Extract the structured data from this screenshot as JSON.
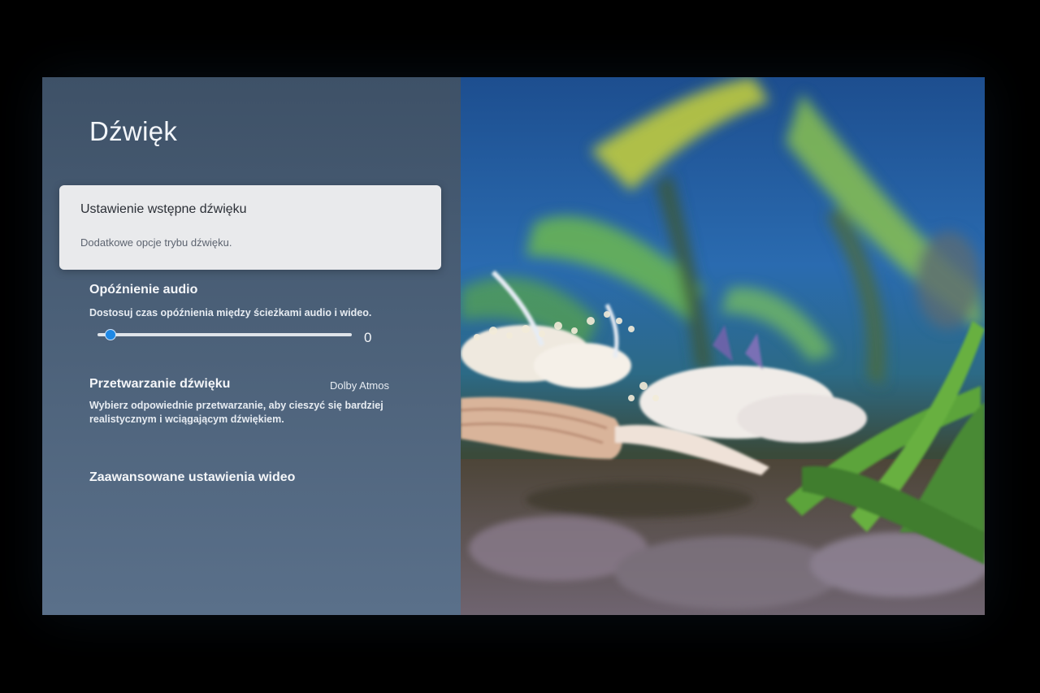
{
  "settings": {
    "title": "Dźwięk",
    "focused_item": {
      "title": "Ustawienie wstępne dźwięku",
      "subtitle": "Dodatkowe opcje trybu dźwięku."
    },
    "audio_delay": {
      "title": "Opóźnienie audio",
      "subtitle": "Dostosuj czas opóźnienia między ścieżkami audio i wideo.",
      "value": "0",
      "slider_fraction": 0.05
    },
    "sound_processing": {
      "title": "Przetwarzanie dźwięku",
      "value": "Dolby Atmos",
      "subtitle_line1": "Wybierz odpowiednie przetwarzanie, aby cieszyć się bardziej",
      "subtitle_line2": "realistycznym i wciągającym dźwiękiem."
    },
    "advanced_video": {
      "title": "Zaawansowane ustawienia wideo"
    }
  },
  "colors": {
    "accent": "#1e88e5",
    "focus_card": "#e9eaec",
    "panel_top": "#3e5167",
    "panel_bottom": "#5a708a"
  }
}
